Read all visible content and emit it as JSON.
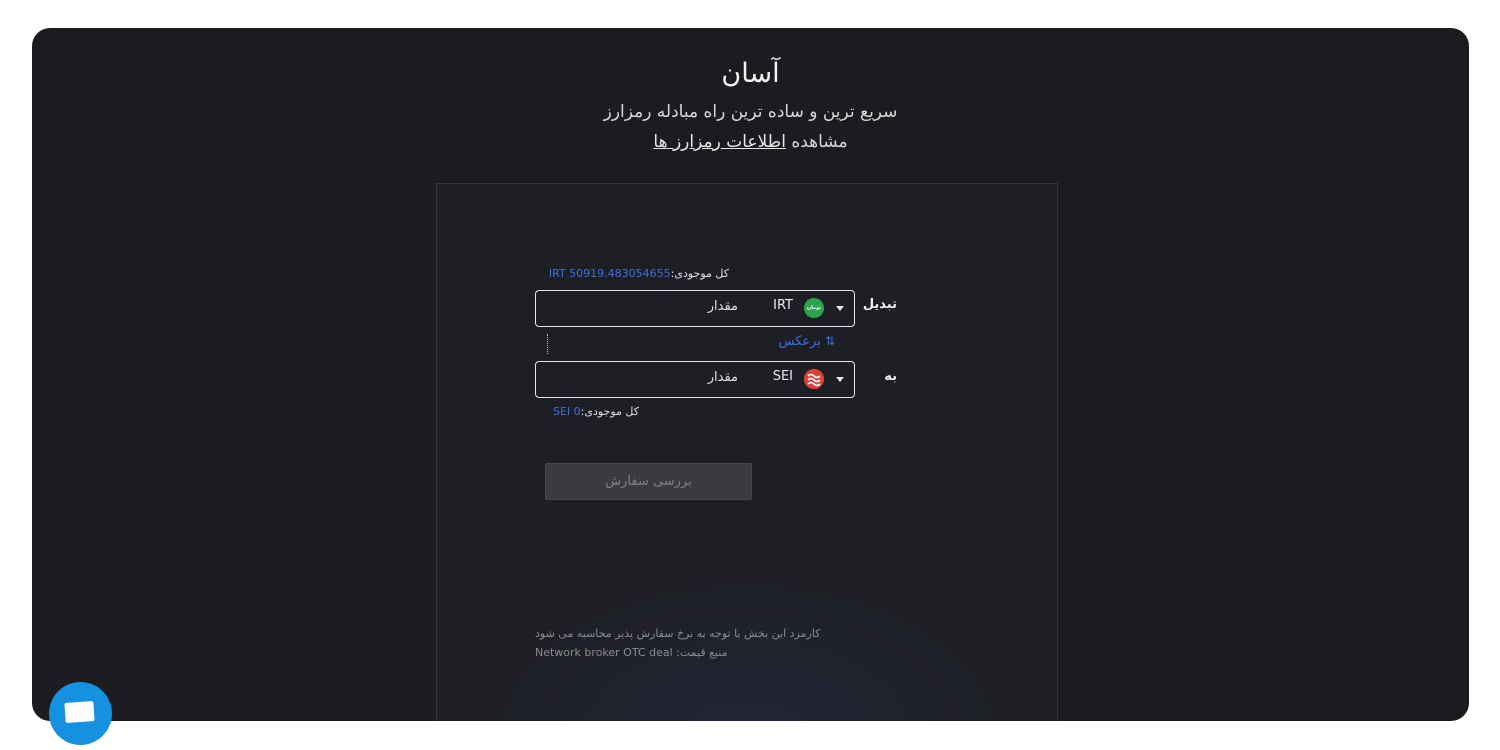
{
  "header": {
    "title": "آسان",
    "subtitle": "سریع ترین و ساده ترین راه مبادله رمزارز",
    "view_prefix": "مشاهده",
    "view_link": "اطلاعات رمزارز ها"
  },
  "form": {
    "from": {
      "balance_label": "کل موجودی:",
      "balance_value": "IRT 50919.483054655",
      "label": "تبدیل",
      "placeholder": "مقدار",
      "currency": "IRT",
      "coin_icon_text": "تومان"
    },
    "reverse_label": "برعکس",
    "to": {
      "label": "به",
      "placeholder": "مقدار",
      "currency": "SEI",
      "balance_label": "کل موجودی:",
      "balance_value": "SEI 0"
    },
    "submit_label": "بررسی سفارش",
    "fee_note": "کارمزد این بخش با توجه به نرخ سفارش پذیر محاسبه می شود",
    "price_source_label": "منبع قیمت:",
    "price_source_value": "Network broker OTC deal"
  },
  "colors": {
    "background": "#1c1c20",
    "card": "#1e1f25",
    "accent": "#3b6fe0",
    "chat": "#1591e0",
    "irt_coin": "#2ea44f",
    "sei_coin": "#d9413b"
  },
  "icons": {
    "reverse": "swap-vertical-icon",
    "dropdown": "chevron-down-icon",
    "chat": "chat-icon"
  }
}
